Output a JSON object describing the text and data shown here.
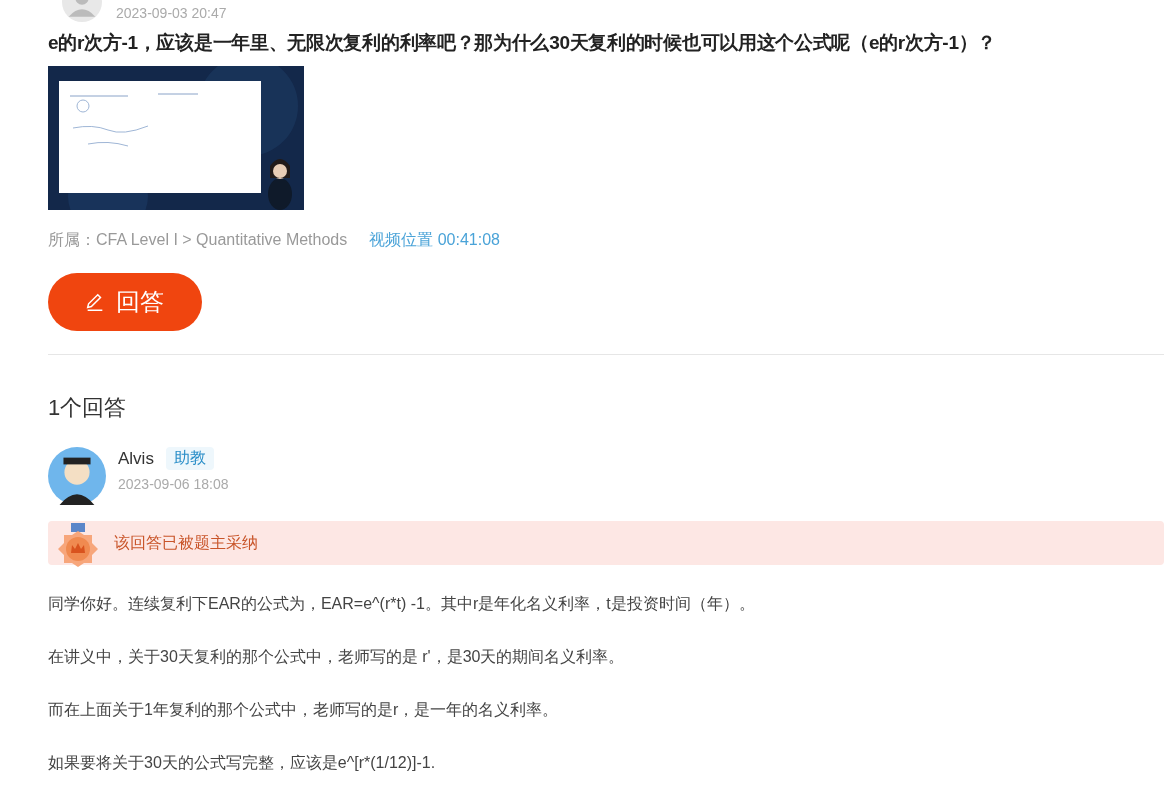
{
  "question": {
    "date": "2023-09-03 20:47",
    "title": "e的r次方-1，应该是一年里、无限次复利的利率吧？那为什么30天复利的时候也可以用这个公式呢（e的r次方-1）？",
    "category": "所属：CFA Level I > Quantitative Methods",
    "video_position": "视频位置 00:41:08",
    "answer_button": "回答"
  },
  "answers_heading": "1个回答",
  "answers": [
    {
      "author": "Alvis",
      "role_tag": "助教",
      "date": "2023-09-06 18:08",
      "accepted": true,
      "accepted_label": "该回答已被题主采纳",
      "paragraphs": [
        "同学你好。连续复利下EAR的公式为，EAR=e^(r*t) -1。其中r是年化名义利率，t是投资时间（年）。",
        "在讲义中，关于30天复利的那个公式中，老师写的是 r'，是30天的期间名义利率。",
        "而在上面关于1年复利的那个公式中，老师写的是r，是一年的名义利率。",
        "如果要将关于30天的公式写完整，应该是e^[r*(1/12)]-1."
      ]
    }
  ]
}
